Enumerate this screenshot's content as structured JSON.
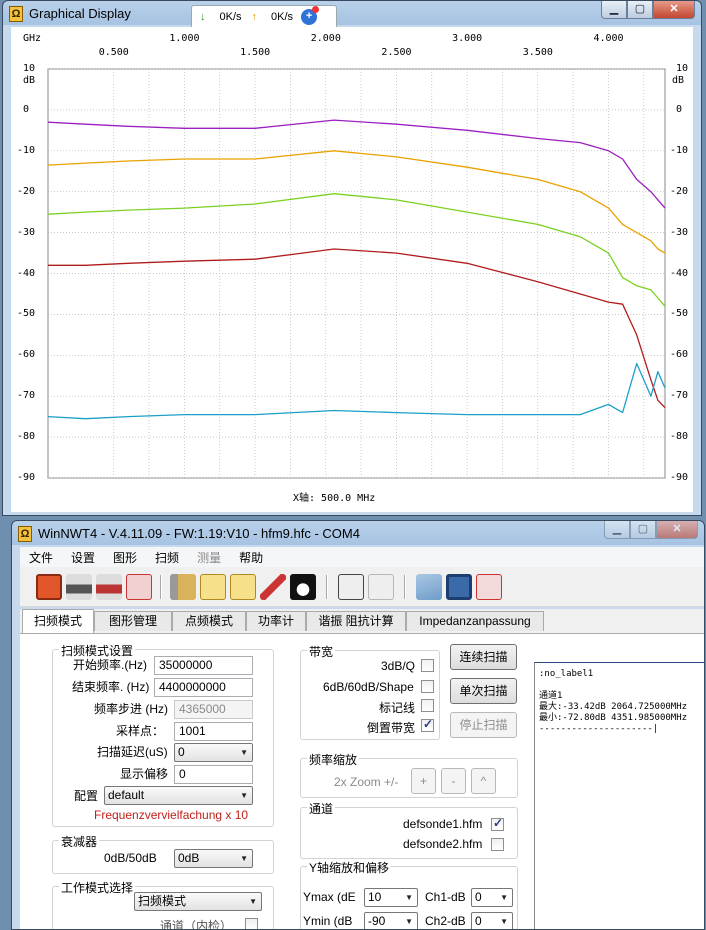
{
  "graph_window": {
    "title": "Graphical Display",
    "net_down": "0K/s",
    "net_up": "0K/s",
    "axis": {
      "x_unit": "GHz",
      "y_unit": "dB",
      "x_caption": "X轴: 500.0 MHz",
      "x_top": [
        "1.000",
        "2.000",
        "3.000",
        "4.000"
      ],
      "x_sub": [
        "0.500",
        "1.500",
        "2.500",
        "3.500"
      ],
      "y": [
        "10",
        "0",
        "-10",
        "-20",
        "-30",
        "-40",
        "-50",
        "-60",
        "-70",
        "-80",
        "-90"
      ]
    }
  },
  "chart_data": {
    "type": "line",
    "xlabel": "X轴: 500.0 MHz",
    "x_unit": "GHz",
    "y_unit": "dB",
    "xlim": [
      0.035,
      4.4
    ],
    "ylim": [
      -90,
      10
    ],
    "grid": true,
    "x": [
      0.035,
      0.3,
      0.6,
      1.0,
      1.5,
      2.06,
      2.5,
      3.0,
      3.5,
      3.8,
      4.0,
      4.1,
      4.2,
      4.3,
      4.35,
      4.4
    ],
    "series": [
      {
        "color": "#9b1fc1",
        "values": [
          -3,
          -3.5,
          -4,
          -4.5,
          -4.5,
          -2.5,
          -3.5,
          -5,
          -7,
          -8,
          -10,
          -12,
          -17,
          -20,
          -22,
          -24
        ]
      },
      {
        "color": "#e9a200",
        "values": [
          -13.5,
          -13,
          -12.5,
          -12,
          -12,
          -10,
          -11.5,
          -14,
          -17,
          -20,
          -24,
          -28,
          -30,
          -32,
          -34,
          -35
        ]
      },
      {
        "color": "#7bd121",
        "values": [
          -25.5,
          -25,
          -24.5,
          -24,
          -23,
          -20.5,
          -22,
          -25,
          -28,
          -31,
          -35,
          -41,
          -43,
          -44,
          -46,
          -48
        ]
      },
      {
        "color": "#b01c1c",
        "values": [
          -38,
          -38,
          -37.5,
          -37,
          -36.5,
          -34,
          -35,
          -37.5,
          -42,
          -45,
          -47,
          -47.5,
          -55,
          -66,
          -71,
          -72.8
        ]
      },
      {
        "color": "#1aa0c8",
        "values": [
          -75,
          -75.5,
          -75,
          -74.5,
          -74.5,
          -73.5,
          -74,
          -74.5,
          -74.5,
          -74.5,
          -72,
          -74,
          -62,
          -70,
          -64,
          -68
        ]
      }
    ]
  },
  "nwt_window": {
    "title": "WinNWT4 - V.4.11.09 - FW:1.19:V10 - hfm9.hfc - COM4",
    "menu": [
      "文件",
      "设置",
      "图形",
      "扫频",
      "测量",
      "帮助"
    ],
    "tabs": [
      "扫频模式",
      "图形管理",
      "点频模式",
      "功率计",
      "谐振 阻抗计算",
      "Impedanzanpassung"
    ],
    "sweep": {
      "group": "扫频模式设置",
      "start_label": "开始频率.(Hz)",
      "start": "35000000",
      "end_label": "结束频率. (Hz)",
      "end": "4400000000",
      "step_label": "频率步进 (Hz)",
      "step": "4365000",
      "points_label": "采样点：",
      "points": "1001",
      "delay_label": "扫描延迟(uS)",
      "delay": "0",
      "offset_label": "显示偏移",
      "offset": "0",
      "config_label": "配置",
      "config": "default",
      "multiplier": "Frequenzvervielfachung x 10"
    },
    "attenuator": {
      "group": "衰减器",
      "label": "0dB/50dB",
      "value": "0dB"
    },
    "workmode": {
      "group": "工作模式选择",
      "value": "扫频模式",
      "sub": "通道（内检）"
    },
    "bandwidth": {
      "group": "带宽",
      "q": "3dB/Q",
      "shape": "6dB/60dB/Shape",
      "marker": "标记线",
      "invert": "倒置带宽"
    },
    "buttons": {
      "continuous": "连续扫描",
      "single": "单次扫描",
      "stop": "停止扫描"
    },
    "zoom": {
      "group": "频率缩放",
      "label": "2x Zoom +/-",
      "plus": "+",
      "minus": "-",
      "up": "^"
    },
    "channel": {
      "group": "通道",
      "ch1": "defsonde1.hfm",
      "ch2": "defsonde2.hfm"
    },
    "yaxis": {
      "group": "Y轴缩放和偏移",
      "ymax_label": "Ymax (dE",
      "ymax": "10",
      "ymin_label": "Ymin (dB",
      "ymin": "-90",
      "ch1_label": "Ch1-dB",
      "ch1": "0",
      "ch2_label": "Ch2-dB",
      "ch2": "0"
    },
    "info": ":no_label1\n\n通道1\n最大:-33.42dB 2064.725000MHz\n最小:-72.80dB 4351.985000MHz\n---------------------|"
  }
}
